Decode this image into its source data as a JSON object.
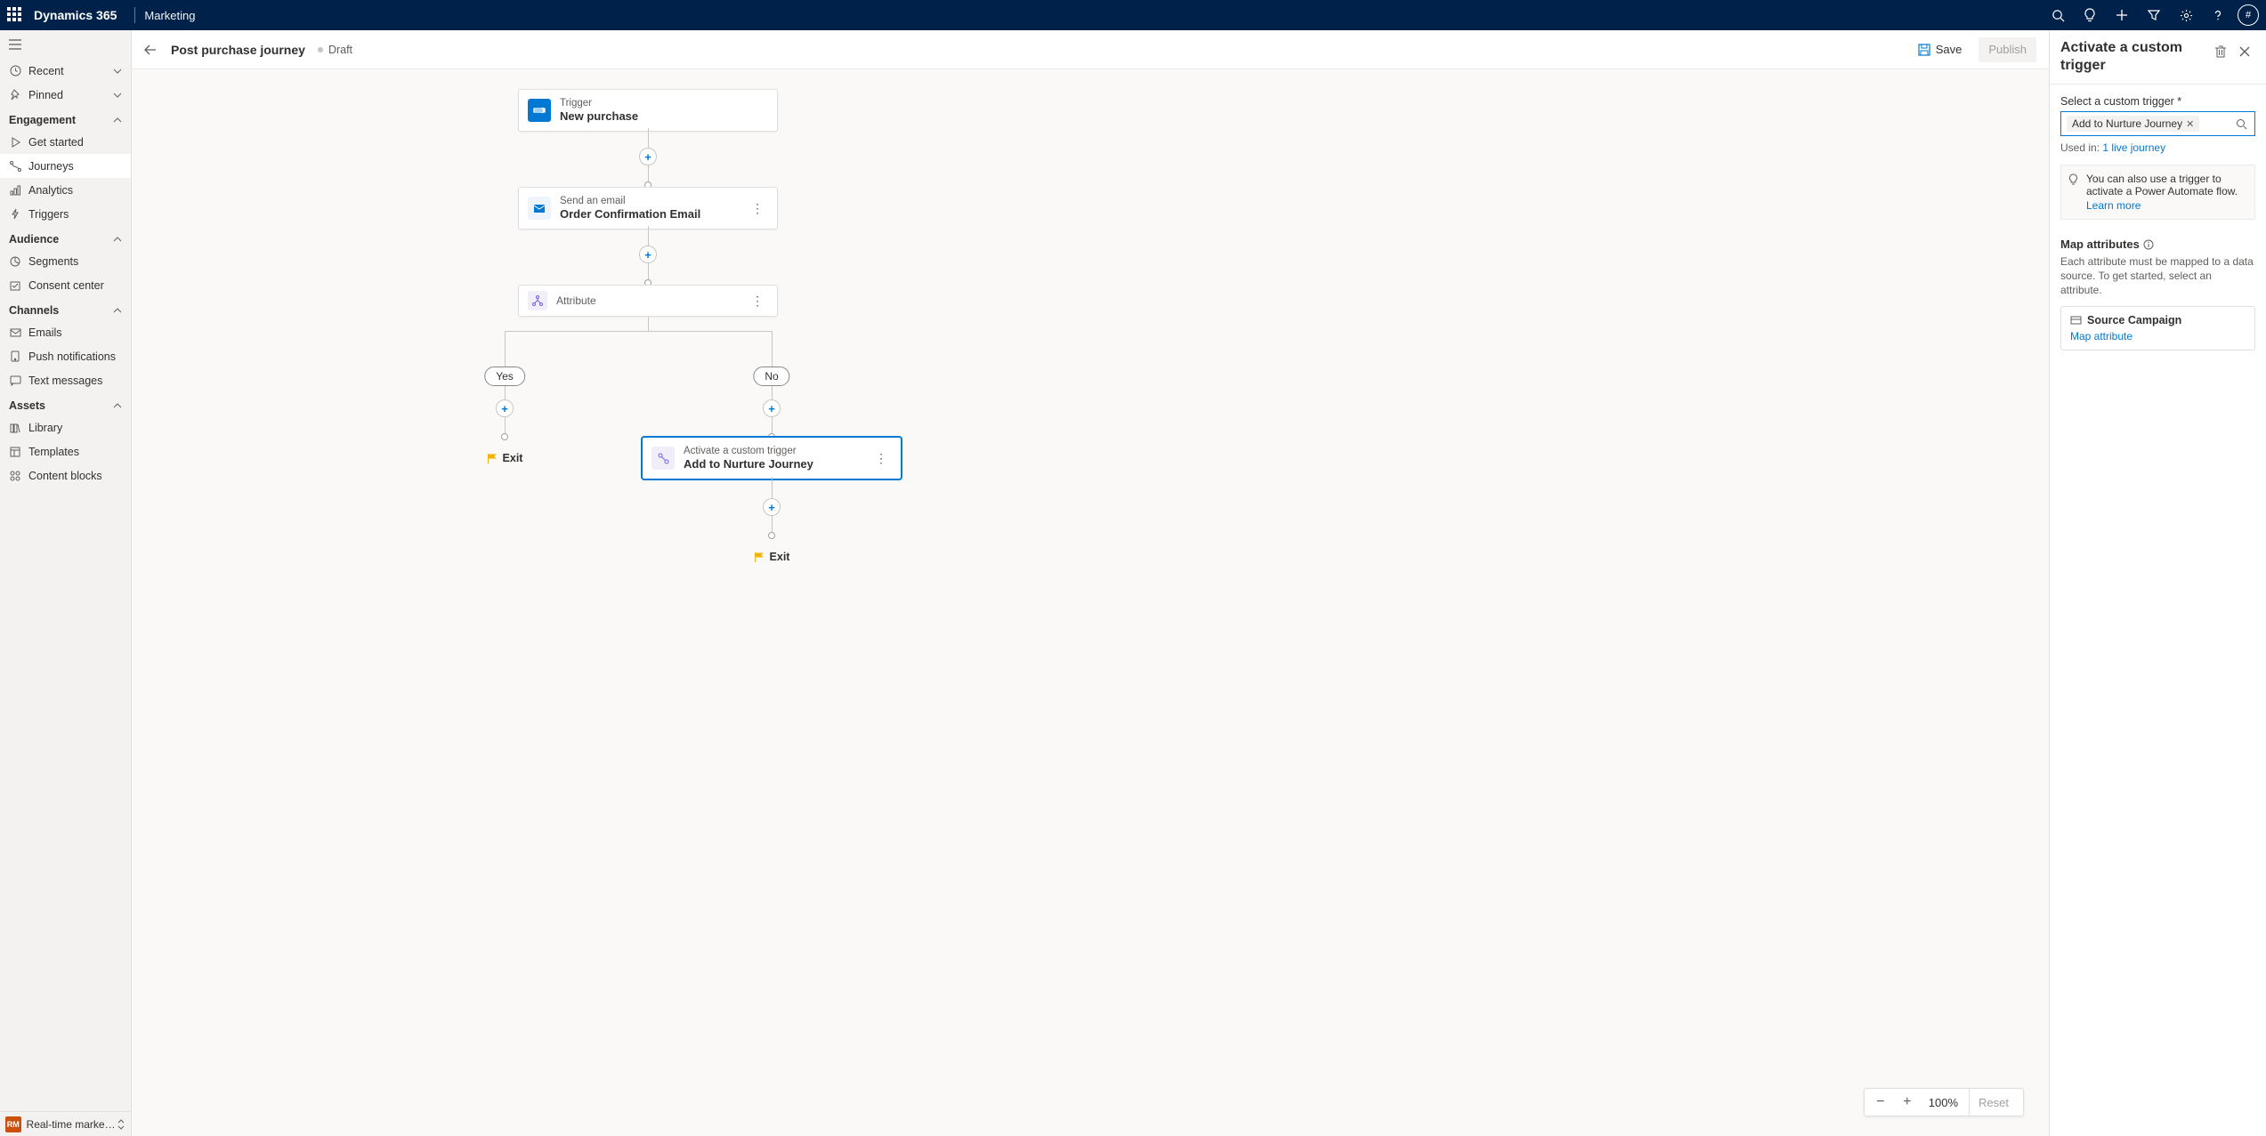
{
  "header": {
    "app": "Dynamics 365",
    "module": "Marketing",
    "avatar": "#"
  },
  "sidebar": {
    "recent": "Recent",
    "pinned": "Pinned",
    "sections": {
      "engagement": {
        "title": "Engagement",
        "items": [
          "Get started",
          "Journeys",
          "Analytics",
          "Triggers"
        ]
      },
      "audience": {
        "title": "Audience",
        "items": [
          "Segments",
          "Consent center"
        ]
      },
      "channels": {
        "title": "Channels",
        "items": [
          "Emails",
          "Push notifications",
          "Text messages"
        ]
      },
      "assets": {
        "title": "Assets",
        "items": [
          "Library",
          "Templates",
          "Content blocks"
        ]
      }
    },
    "bottom": {
      "badge": "RM",
      "label": "Real-time marketi..."
    }
  },
  "page": {
    "title": "Post purchase journey",
    "status": "Draft",
    "save": "Save",
    "publish": "Publish"
  },
  "canvas": {
    "trigger": {
      "label": "Trigger",
      "title": "New purchase"
    },
    "email": {
      "label": "Send an email",
      "title": "Order Confirmation Email"
    },
    "attribute": {
      "label": "Attribute"
    },
    "yes": "Yes",
    "no": "No",
    "custom": {
      "label": "Activate a custom trigger",
      "title": "Add to Nurture Journey"
    },
    "exit": "Exit"
  },
  "zoom": {
    "pct": "100%",
    "reset": "Reset"
  },
  "panel": {
    "title": "Activate a custom trigger",
    "field_label": "Select a custom trigger *",
    "chip": "Add to Nurture Journey",
    "usedin_prefix": "Used in: ",
    "usedin_link": "1 live journey",
    "info": "You can also use a trigger to activate a Power Automate flow.",
    "learn": "Learn more",
    "map_title": "Map attributes",
    "map_desc": "Each attribute must be mapped to a data source. To get started, select an attribute.",
    "attr_name": "Source Campaign",
    "attr_link": "Map attribute"
  }
}
